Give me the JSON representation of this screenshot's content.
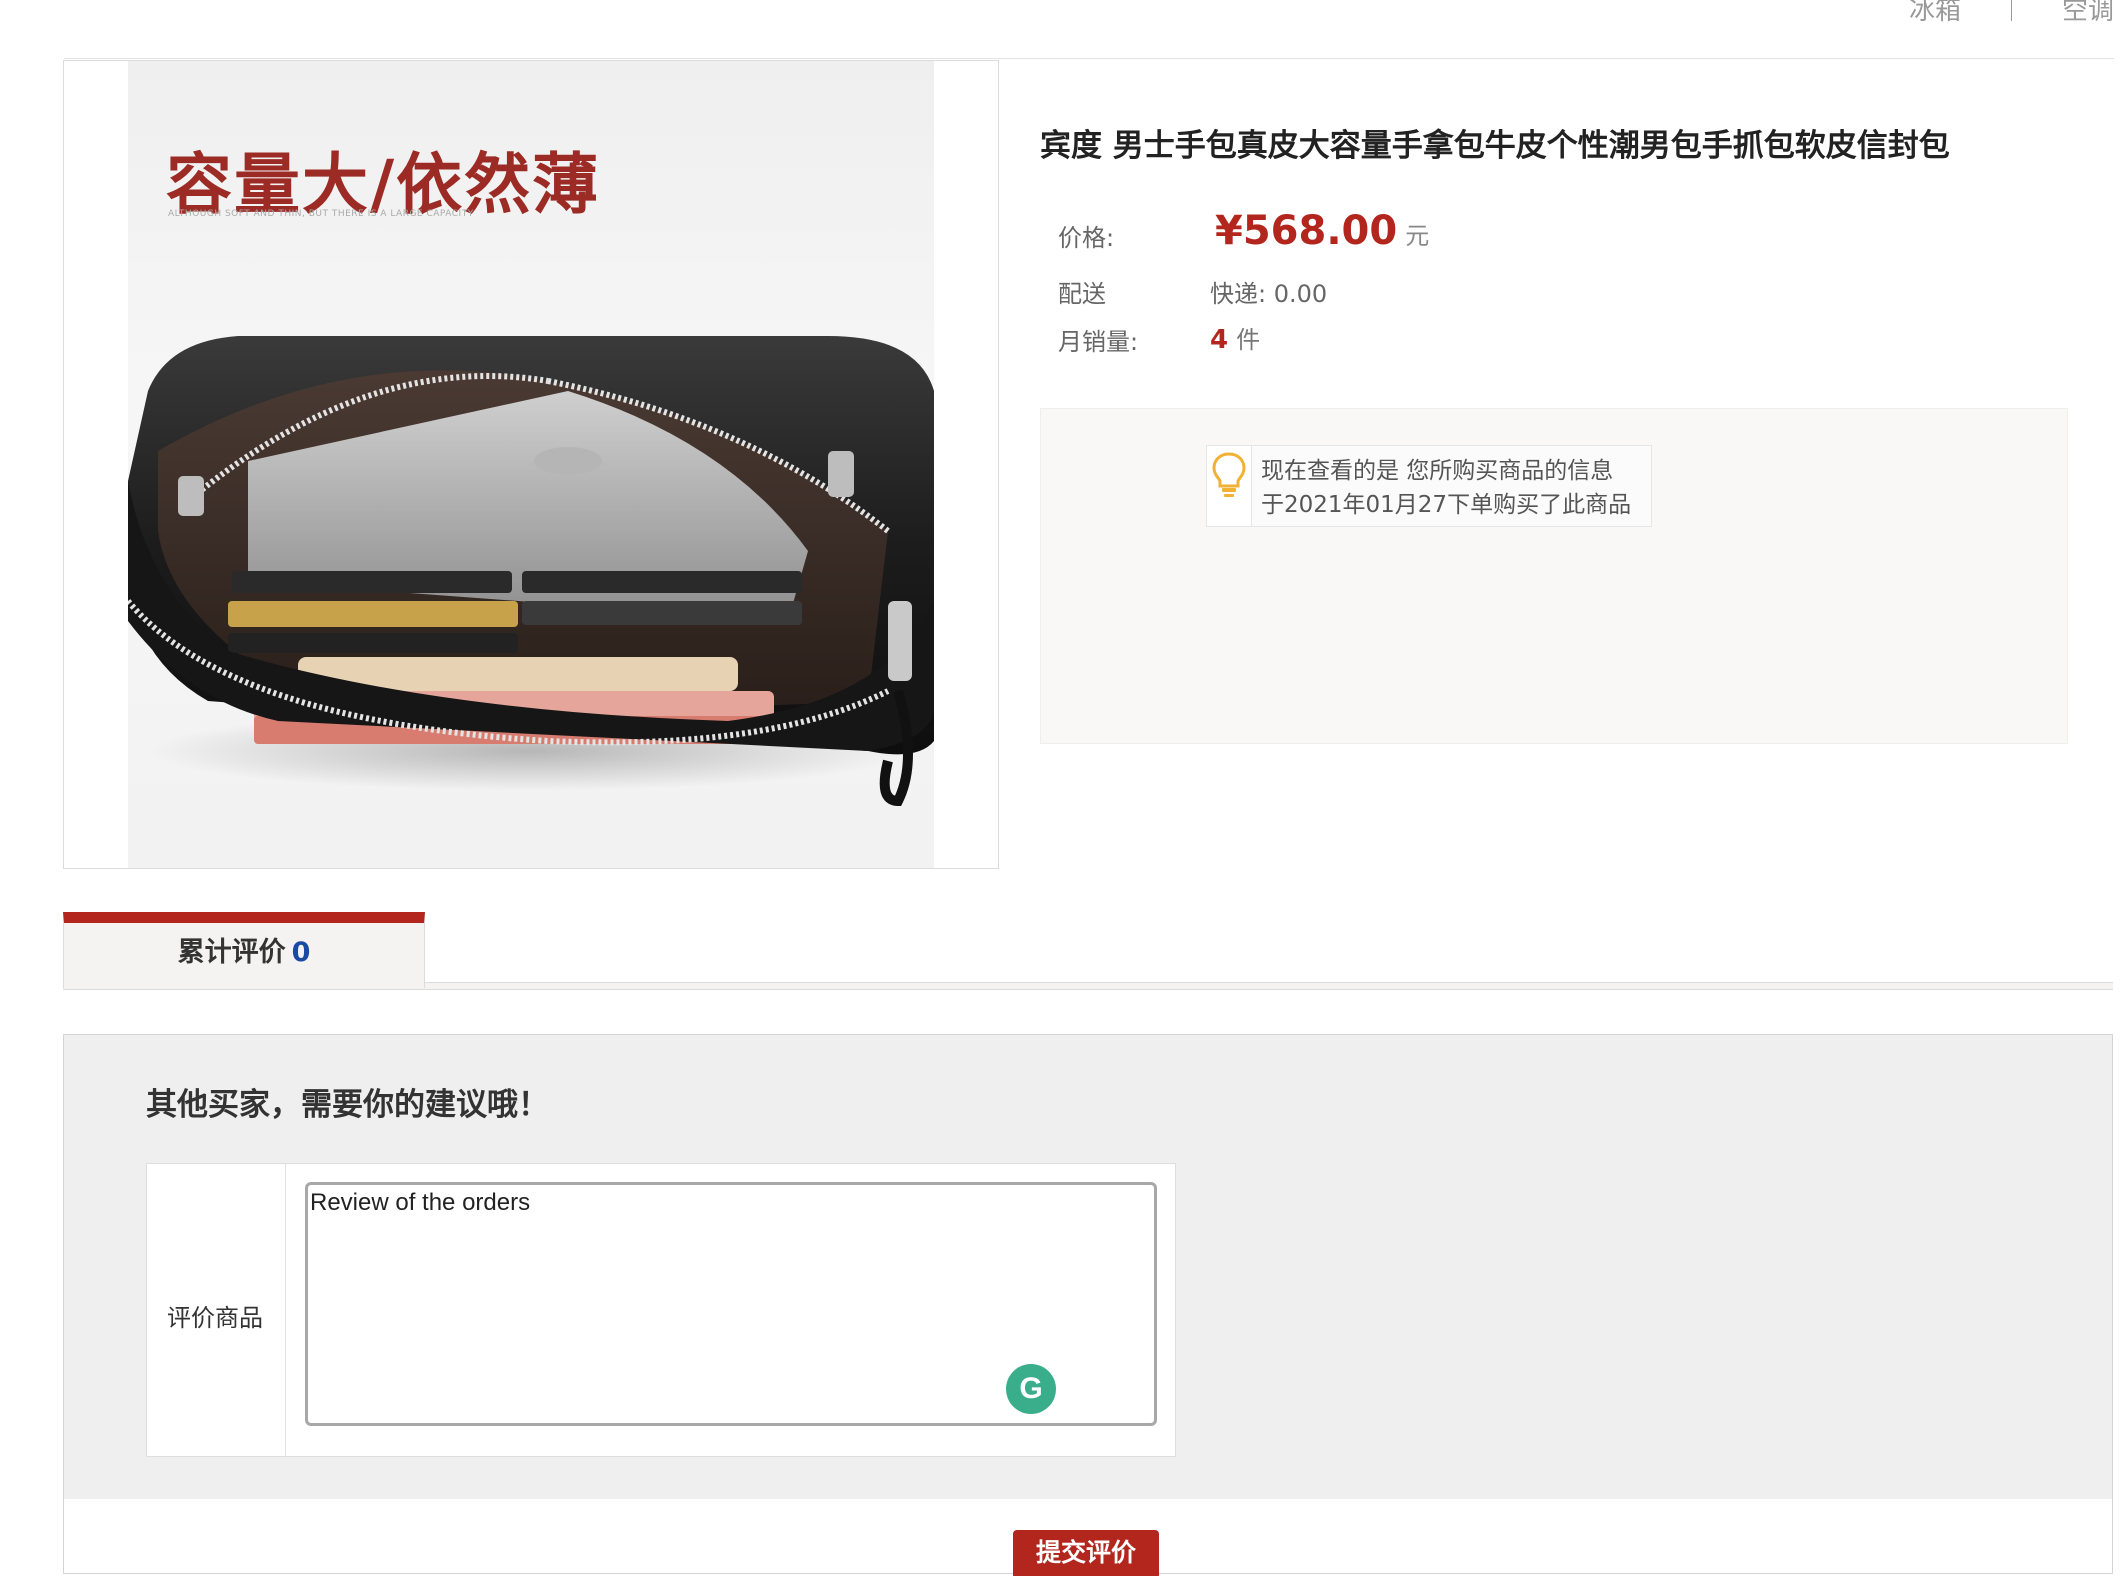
{
  "top_nav": {
    "items": [
      "冰箱",
      "空调"
    ]
  },
  "product": {
    "image": {
      "headline": "容量大/依然薄",
      "subline": "ALTHOUGH SOFT AND THIN, BUT THERE IS A LARGE CAPACITY"
    },
    "title": "宾度 男士手包真皮大容量手拿包牛皮个性潮男包手抓包软皮信封包",
    "price_label": "价格:",
    "price_value": "¥568.00",
    "price_unit": "元",
    "shipping_label": "配送",
    "shipping_value": "快递: 0.00",
    "monthly_sales_label": "月销量:",
    "monthly_sales_value": "4",
    "monthly_sales_unit": "件",
    "notice": {
      "line1": "现在查看的是 您所购买商品的信息",
      "line2": "于2021年01月27下单购买了此商品",
      "icon": "lightbulb-icon"
    }
  },
  "tabs": [
    {
      "label": "累计评价",
      "count": "0"
    }
  ],
  "review": {
    "heading": "其他买家，需要你的建议哦！",
    "field_label": "评价商品",
    "textarea_value": "Review of the orders",
    "submit_label": "提交评价",
    "grammarly_icon": "grammarly-icon"
  },
  "colors": {
    "accent_red": "#b2261e",
    "count_blue": "#1a4aa3",
    "grammarly_green": "#3aad8b"
  }
}
